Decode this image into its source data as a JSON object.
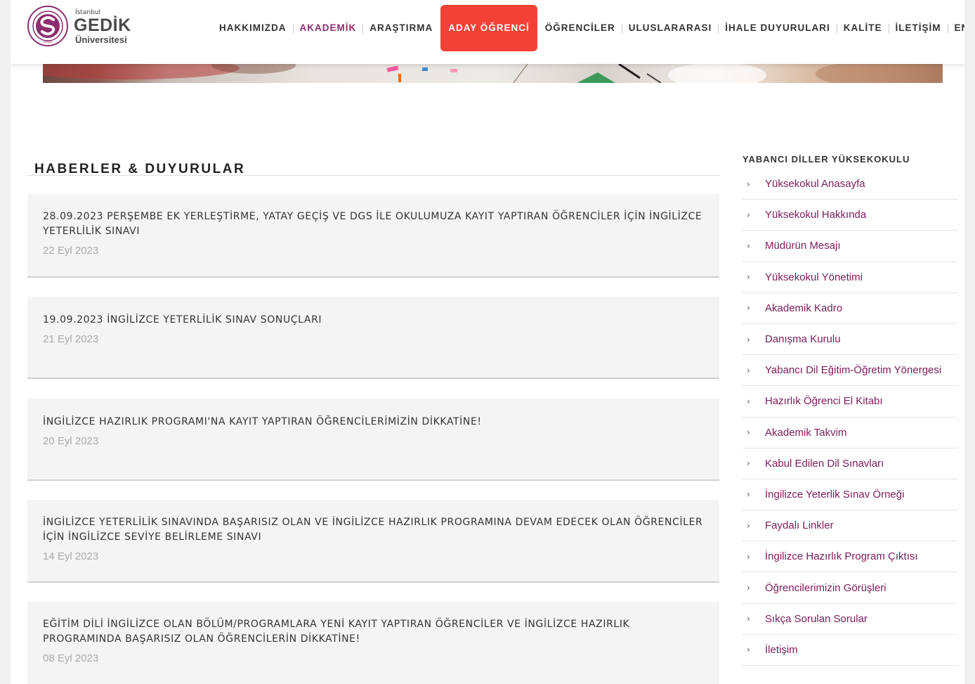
{
  "logo": {
    "small_text": "İstanbul",
    "name": "GEDİK",
    "subtitle": "Üniversitesi",
    "emblem_ring_text": "T.C. İstanbul Gedik Üniversitesi",
    "emblem_year": "2010",
    "brand_color": "#8b2e6f"
  },
  "nav": {
    "items": [
      {
        "label": "HAKKIMIZDA"
      },
      {
        "label": "AKADEMİK"
      },
      {
        "label": "ARAŞTIRMA"
      },
      {
        "label": "ADAY ÖĞRENCİ"
      },
      {
        "label": "ÖĞRENCİLER"
      },
      {
        "label": "ULUSLARARASI"
      },
      {
        "label": "İHALE DUYURULARI"
      },
      {
        "label": "KALİTE"
      },
      {
        "label": "İLETİŞİM"
      },
      {
        "label": "EN"
      }
    ],
    "active_color": "#8b2e6f",
    "cta_color": "#f34135"
  },
  "news": {
    "title": "HABERLER & DUYURULAR",
    "items": [
      {
        "title": "28.09.2023 PERŞEMBE EK YERLEŞTİRME, YATAY GEÇİŞ VE DGS İLE OKULUMUZA KAYIT YAPTIRAN ÖĞRENCİLER İÇİN İNGİLİZCE YETERLİLİK SINAVI",
        "date": "22 Eyl 2023"
      },
      {
        "title": "19.09.2023 İNGİLİZCE YETERLİLİK SINAV SONUÇLARI",
        "date": "21 Eyl 2023"
      },
      {
        "title": "İNGİLİZCE HAZIRLIK PROGRAMI'NA KAYIT YAPTIRAN ÖĞRENCİLERİMİZİN DİKKATİNE!",
        "date": "20 Eyl 2023"
      },
      {
        "title": "İNGİLİZCE YETERLİLİK SINAVINDA BAŞARISIZ OLAN VE İNGİLİZCE HAZIRLIK PROGRAMINA DEVAM EDECEK OLAN ÖĞRENCİLER İÇİN İNGİLİZCE SEVİYE BELİRLEME SINAVI",
        "date": "14 Eyl 2023"
      },
      {
        "title": "EĞİTİM DİLİ İNGİLİZCE OLAN BÖLÜM/PROGRAMLARA YENİ KAYIT YAPTIRAN ÖĞRENCİLER VE İNGİLİZCE HAZIRLIK PROGRAMINDA BAŞARISIZ OLAN ÖĞRENCİLERİN DİKKATİNE!",
        "date": "08 Eyl 2023"
      }
    ]
  },
  "sidebar": {
    "title": "YABANCI DİLLER YÜKSEKOKULU",
    "items": [
      {
        "label": "Yüksekokul Anasayfa"
      },
      {
        "label": "Yüksekokul Hakkında"
      },
      {
        "label": "Müdürün Mesajı"
      },
      {
        "label": "Yüksekokul Yönetimi"
      },
      {
        "label": "Akademik Kadro"
      },
      {
        "label": "Danışma Kurulu"
      },
      {
        "label": "Yabancı Dil Eğitim-Öğretim Yönergesi"
      },
      {
        "label": "Hazırlık Öğrenci El Kitabı"
      },
      {
        "label": "Akademik Takvim"
      },
      {
        "label": "Kabul Edilen Dil Sınavları"
      },
      {
        "label": "İngilizce Yeterlik Sınav Örneği"
      },
      {
        "label": "Faydalı Linkler"
      },
      {
        "label": "İngilizce Hazırlık Program Çıktısı"
      },
      {
        "label": "Öğrencilerimizin Görüşleri"
      },
      {
        "label": "Sıkça Sorulan Sorular"
      },
      {
        "label": "İletişim"
      }
    ],
    "chevron_icon": "chevron-right-icon"
  }
}
